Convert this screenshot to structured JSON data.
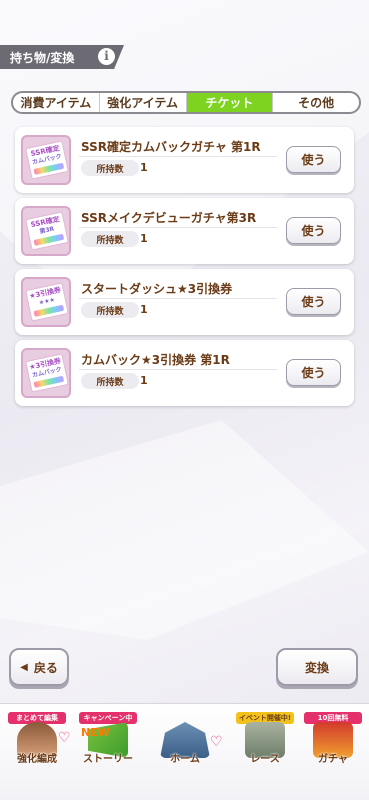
{
  "header": {
    "title": "持ち物/変換",
    "info_glyph": "i"
  },
  "tabs": [
    {
      "label": "消費アイテム",
      "active": false
    },
    {
      "label": "強化アイテム",
      "active": false
    },
    {
      "label": "チケット",
      "active": true
    },
    {
      "label": "その他",
      "active": false
    }
  ],
  "items": [
    {
      "name": "SSR確定カムバックガチャ 第1R",
      "qty_label": "所持数",
      "qty": "1",
      "use_label": "使う",
      "ticket_top": "SSR確定",
      "ticket_sub": "カムバック"
    },
    {
      "name": "SSRメイクデビューガチャ第3R",
      "qty_label": "所持数",
      "qty": "1",
      "use_label": "使う",
      "ticket_top": "SSR確定",
      "ticket_sub": "第3R"
    },
    {
      "name": "スタートダッシュ★3引換券",
      "qty_label": "所持数",
      "qty": "1",
      "use_label": "使う",
      "ticket_top": "★3引換券",
      "ticket_sub": "★★★"
    },
    {
      "name": "カムバック★3引換券 第1R",
      "qty_label": "所持数",
      "qty": "1",
      "use_label": "使う",
      "ticket_top": "★3引換券",
      "ticket_sub": "カムバック"
    }
  ],
  "buttons": {
    "back_label": "戻る",
    "back_arrow": "◀",
    "convert_label": "変換"
  },
  "nav": [
    {
      "label": "強化編成",
      "badge": "まとめて編集"
    },
    {
      "label": "ストーリー",
      "badge": "キャンペーン中"
    },
    {
      "label": "ホーム",
      "badge": ""
    },
    {
      "label": "レース",
      "badge": "イベント開催中!"
    },
    {
      "label": "ガチャ",
      "badge": "10回無料"
    }
  ],
  "nav_extra": {
    "new_text": "NEW",
    "heart": "♡"
  },
  "colors": {
    "active_tab": "#7ed321",
    "text_brown": "#6b3c17",
    "header_gray": "#6c6a73",
    "badge_pink": "#e4306b"
  }
}
